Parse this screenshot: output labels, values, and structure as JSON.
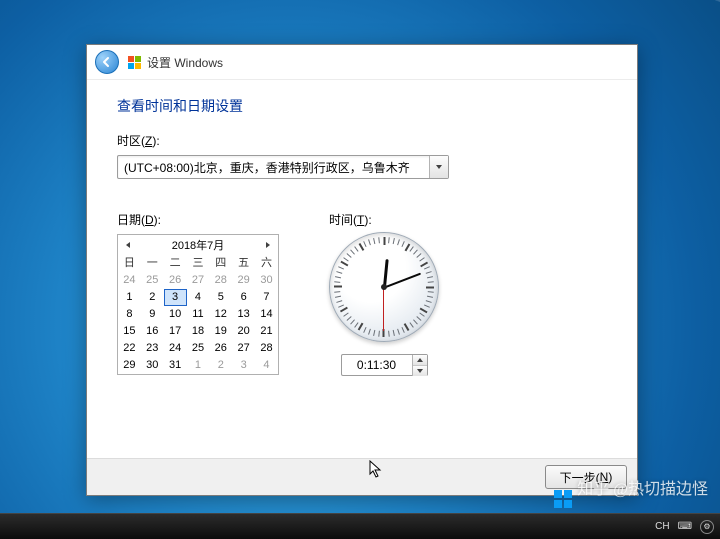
{
  "header": {
    "app_title": "设置 Windows"
  },
  "page": {
    "title": "查看时间和日期设置",
    "tz_label_pre": "时区(",
    "tz_hotkey": "Z",
    "tz_label_post": "):",
    "date_label_pre": "日期(",
    "date_hotkey": "D",
    "date_label_post": "):",
    "time_label_pre": "时间(",
    "time_hotkey": "T",
    "time_label_post": "):"
  },
  "timezone": {
    "selected": "(UTC+08:00)北京，重庆，香港特别行政区，乌鲁木齐"
  },
  "calendar": {
    "month_title": "2018年7月",
    "dow": [
      "日",
      "一",
      "二",
      "三",
      "四",
      "五",
      "六"
    ],
    "selected_day": 3,
    "selected_year": 2018,
    "selected_month": 7,
    "weeks": [
      [
        {
          "n": 24,
          "out": true
        },
        {
          "n": 25,
          "out": true
        },
        {
          "n": 26,
          "out": true
        },
        {
          "n": 27,
          "out": true
        },
        {
          "n": 28,
          "out": true
        },
        {
          "n": 29,
          "out": true
        },
        {
          "n": 30,
          "out": true
        }
      ],
      [
        {
          "n": 1
        },
        {
          "n": 2
        },
        {
          "n": 3,
          "sel": true
        },
        {
          "n": 4
        },
        {
          "n": 5
        },
        {
          "n": 6
        },
        {
          "n": 7
        }
      ],
      [
        {
          "n": 8
        },
        {
          "n": 9
        },
        {
          "n": 10
        },
        {
          "n": 11
        },
        {
          "n": 12
        },
        {
          "n": 13
        },
        {
          "n": 14
        }
      ],
      [
        {
          "n": 15
        },
        {
          "n": 16
        },
        {
          "n": 17
        },
        {
          "n": 18
        },
        {
          "n": 19
        },
        {
          "n": 20
        },
        {
          "n": 21
        }
      ],
      [
        {
          "n": 22
        },
        {
          "n": 23
        },
        {
          "n": 24
        },
        {
          "n": 25
        },
        {
          "n": 26
        },
        {
          "n": 27
        },
        {
          "n": 28
        }
      ],
      [
        {
          "n": 29
        },
        {
          "n": 30
        },
        {
          "n": 31
        },
        {
          "n": 1,
          "out": true
        },
        {
          "n": 2,
          "out": true
        },
        {
          "n": 3,
          "out": true
        },
        {
          "n": 4,
          "out": true
        }
      ]
    ]
  },
  "clock": {
    "time_text": "0:11:30",
    "hour": 0,
    "minute": 11,
    "second": 30
  },
  "footer": {
    "next_label_pre": "下一步(",
    "next_hotkey": "N",
    "next_label_post": ")"
  },
  "taskbar": {
    "lang": "CH"
  },
  "watermark": {
    "text": "知乎 @热切描边怪"
  }
}
